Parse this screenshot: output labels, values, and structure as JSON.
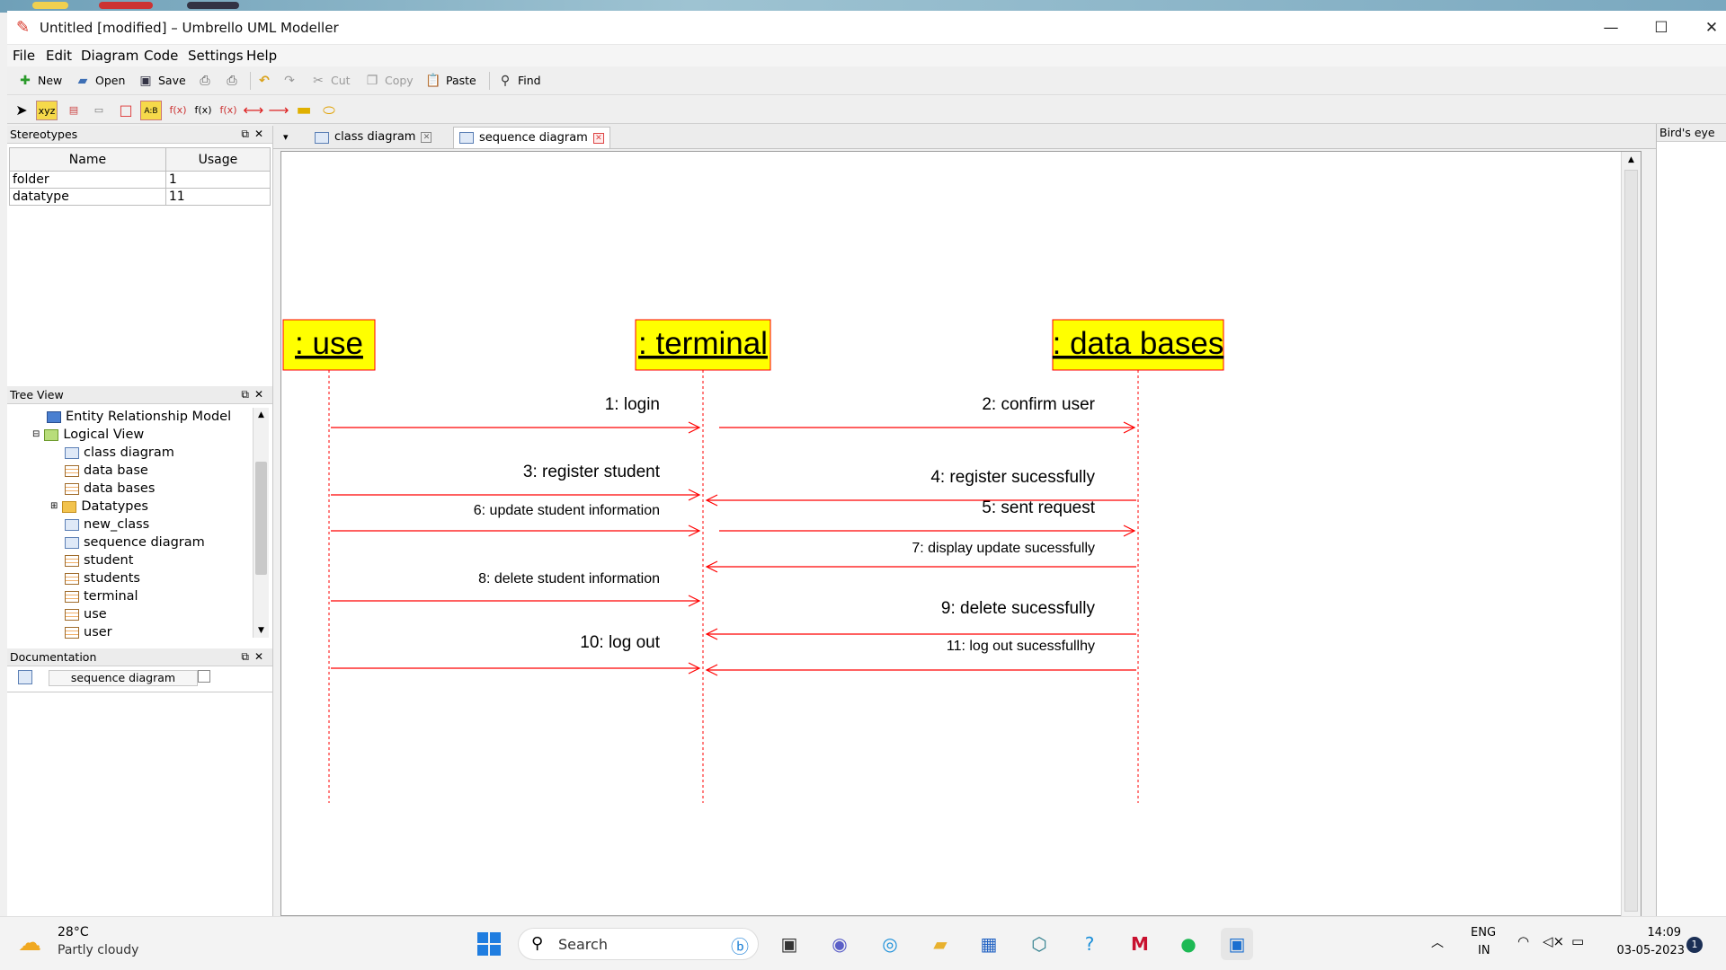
{
  "window": {
    "title": "Untitled [modified] – Umbrello UML Modeller",
    "minimize": "—",
    "maximize": "☐",
    "close": "✕"
  },
  "menu": [
    "File",
    "Edit",
    "Diagram",
    "Code",
    "Settings",
    "Help"
  ],
  "toolbar": {
    "new": "New",
    "open": "Open",
    "save": "Save",
    "cut": "Cut",
    "copy": "Copy",
    "paste": "Paste",
    "find": "Find"
  },
  "drawing_tools": [
    "select",
    "xyz",
    "class",
    "note",
    "box",
    "A:B",
    "f(x)",
    "f(x)",
    "f(x)",
    "message",
    "message-lost",
    "note-box",
    "state"
  ],
  "stereotypes": {
    "title": "Stereotypes",
    "columns": [
      "Name",
      "Usage"
    ],
    "rows": [
      {
        "name": "folder",
        "usage": "1"
      },
      {
        "name": "datatype",
        "usage": "11"
      }
    ]
  },
  "tree_view": {
    "title": "Tree View",
    "items": [
      {
        "label": "Entity Relationship Model",
        "icon": "model"
      },
      {
        "label": "Logical View",
        "icon": "folder-open"
      },
      {
        "label": "class diagram",
        "icon": "diagram"
      },
      {
        "label": "data base",
        "icon": "class"
      },
      {
        "label": "data bases",
        "icon": "class"
      },
      {
        "label": "Datatypes",
        "icon": "folder"
      },
      {
        "label": "new_class",
        "icon": "diagram"
      },
      {
        "label": "sequence diagram",
        "icon": "diagram"
      },
      {
        "label": "student",
        "icon": "class"
      },
      {
        "label": "students",
        "icon": "class"
      },
      {
        "label": "terminal",
        "icon": "class"
      },
      {
        "label": "use",
        "icon": "class"
      },
      {
        "label": "user",
        "icon": "class"
      }
    ]
  },
  "documentation": {
    "title": "Documentation",
    "field": "sequence diagram"
  },
  "tabs": [
    {
      "label": "class diagram",
      "active": false
    },
    {
      "label": "sequence diagram",
      "active": true
    }
  ],
  "birds_eye": {
    "title": "Bird's eye"
  },
  "diagram": {
    "lifelines": [
      {
        "id": "use",
        "label": ": use"
      },
      {
        "id": "terminal",
        "label": ": terminal"
      },
      {
        "id": "db",
        "label": ": data bases"
      }
    ],
    "messages": [
      {
        "label": "1: login",
        "from": "use",
        "to": "terminal"
      },
      {
        "label": "2: confirm user",
        "from": "terminal",
        "to": "db"
      },
      {
        "label": "3: register student",
        "from": "use",
        "to": "terminal"
      },
      {
        "label": "4: register sucessfully",
        "from": "db",
        "to": "terminal"
      },
      {
        "label": "6: update student information",
        "from": "use",
        "to": "terminal"
      },
      {
        "label": "5: sent request",
        "from": "terminal",
        "to": "db"
      },
      {
        "label": "7: display update sucessfully",
        "from": "db",
        "to": "terminal"
      },
      {
        "label": "8: delete student information",
        "from": "use",
        "to": "terminal"
      },
      {
        "label": "9: delete sucessfully",
        "from": "db",
        "to": "terminal"
      },
      {
        "label": "10: log out",
        "from": "use",
        "to": "terminal"
      },
      {
        "label": "11: log out sucessfullhy",
        "from": "db",
        "to": "terminal"
      }
    ],
    "colors": {
      "lifeline_fill": "#ffff00",
      "lifeline_border": "#ff0000",
      "message": "#ff0000"
    }
  },
  "taskbar": {
    "weather_temp": "28°C",
    "weather_desc": "Partly cloudy",
    "search_placeholder": "Search",
    "lang_top": "ENG",
    "lang_bottom": "IN",
    "time": "14:09",
    "date": "03-05-2023",
    "notification_count": "1"
  }
}
